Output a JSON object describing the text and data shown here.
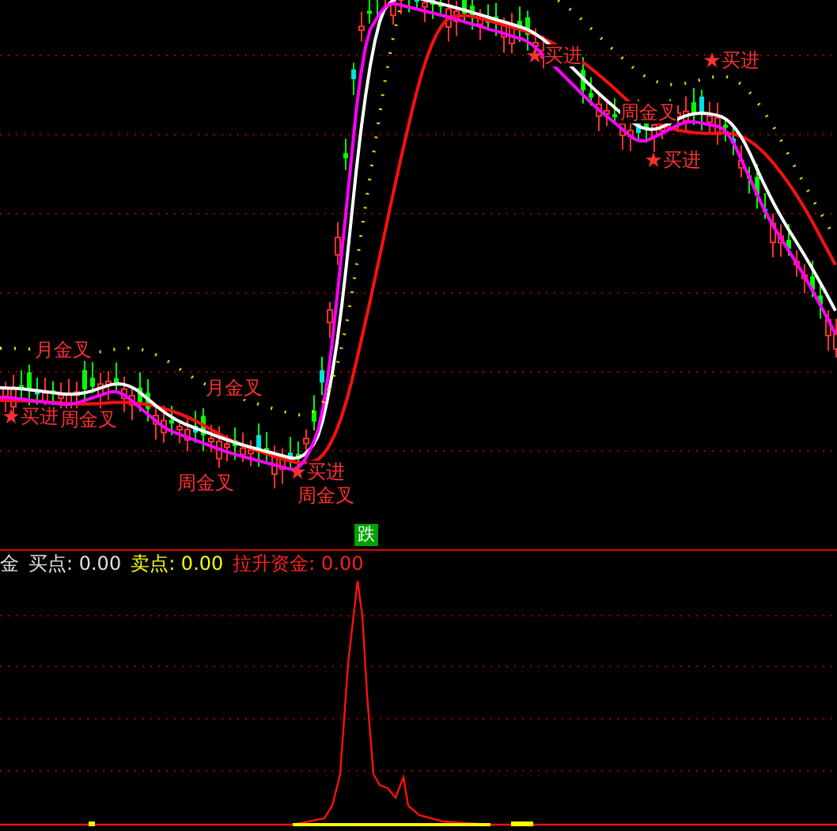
{
  "signals": [
    {
      "kind": "cross",
      "text": "月金叉"
    },
    {
      "kind": "buy",
      "text": "买进"
    },
    {
      "kind": "cross",
      "text": "周金叉"
    },
    {
      "kind": "cross",
      "text": "月金叉"
    },
    {
      "kind": "cross",
      "text": "周金叉"
    },
    {
      "kind": "buy",
      "text": "买进"
    },
    {
      "kind": "cross",
      "text": "周金叉"
    },
    {
      "kind": "buy",
      "text": "买进"
    },
    {
      "kind": "cross",
      "text": "周金叉"
    },
    {
      "kind": "buy",
      "text": "买进"
    },
    {
      "kind": "buy",
      "text": "买进"
    }
  ],
  "trend_badge": "跌",
  "legend": [
    {
      "kind": "neutral",
      "text": "金"
    },
    {
      "kind": "neutral",
      "text": "买点: 0.00"
    },
    {
      "kind": "warn",
      "text": "卖点: 0.00"
    },
    {
      "kind": "alert",
      "text": "拉升资金: 0.00"
    }
  ]
}
